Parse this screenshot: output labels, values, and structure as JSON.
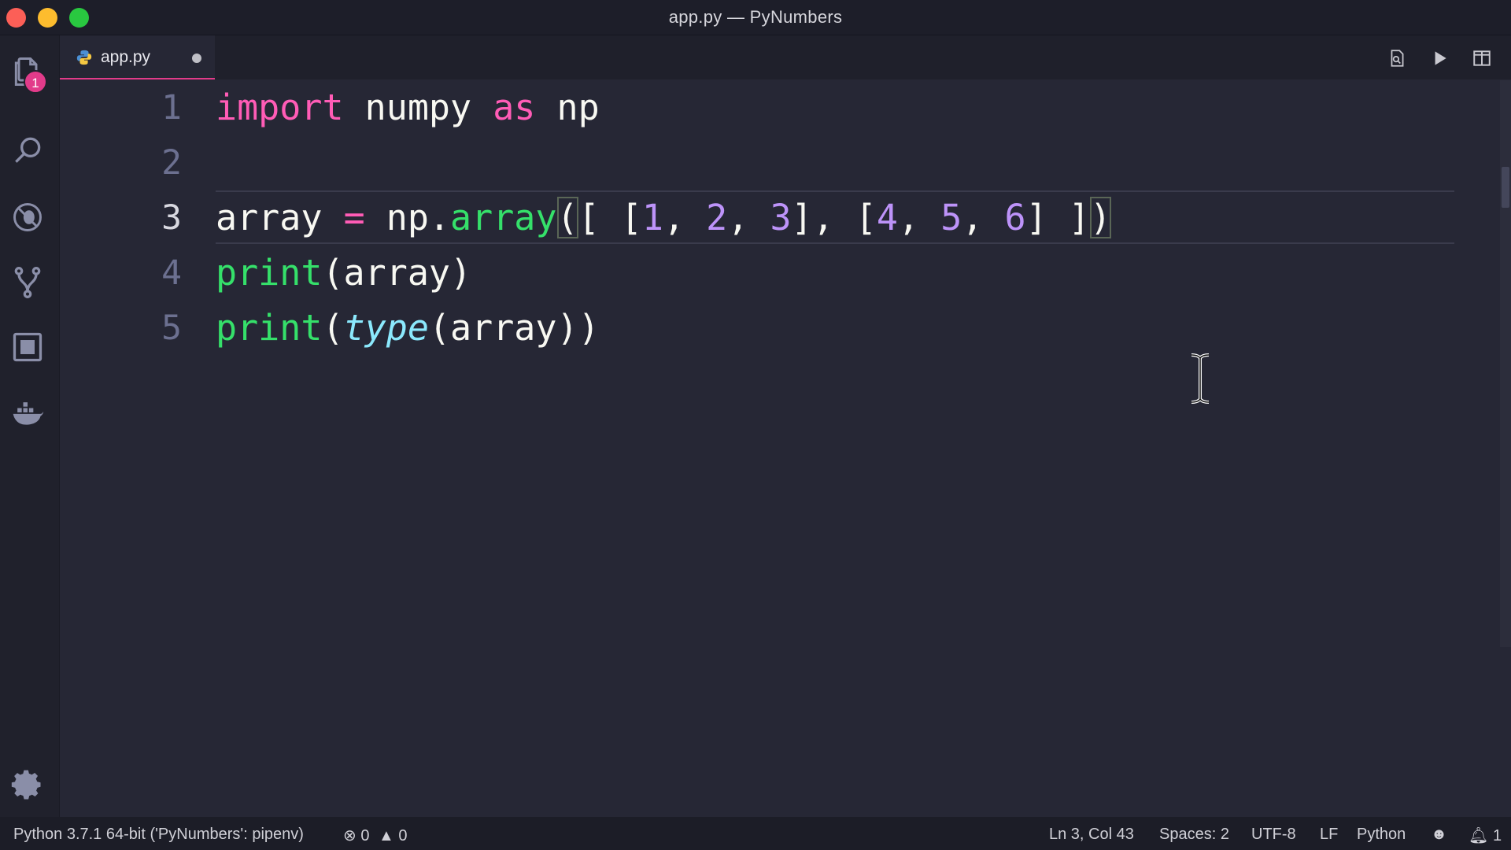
{
  "window": {
    "title": "app.py — PyNumbers"
  },
  "activity_bar": {
    "explorer_badge": "1"
  },
  "tab": {
    "label": "app.py"
  },
  "editor": {
    "line_numbers": [
      "1",
      "2",
      "3",
      "4",
      "5"
    ],
    "lines": {
      "l1": {
        "import": "import",
        "sp1": " ",
        "numpy": "numpy",
        "sp2": " ",
        "as": "as",
        "sp3": " ",
        "np": "np"
      },
      "l3": {
        "array": "array",
        "sp1": " ",
        "eq": "=",
        "sp2": " ",
        "np": "np.",
        "fn": "array",
        "open": "(",
        "t1": "[ [",
        "n1": "1",
        "c1": ", ",
        "n2": "2",
        "c2": ", ",
        "n3": "3",
        "t2": "], [",
        "n4": "4",
        "c3": ", ",
        "n5": "5",
        "c4": ", ",
        "n6": "6",
        "t3": "] ]",
        "close": ")"
      },
      "l4": {
        "print": "print",
        "rest": "(array)"
      },
      "l5": {
        "print": "print",
        "open": "(",
        "type": "type",
        "rest": "(array))"
      }
    }
  },
  "status_bar": {
    "interpreter": "Python 3.7.1 64-bit ('PyNumbers': pipenv)",
    "errors": "0",
    "warnings": "0",
    "position": "Ln 3, Col 43",
    "spaces": "Spaces: 2",
    "encoding": "UTF-8",
    "eol": "LF",
    "language": "Python",
    "notifications": "1"
  },
  "colors": {
    "background": "#262735",
    "keyword": "#ff5cb6",
    "function": "#35e06a",
    "number": "#bd93f9",
    "builtin": "#8be9fd",
    "tab_accent": "#e23b8a"
  }
}
